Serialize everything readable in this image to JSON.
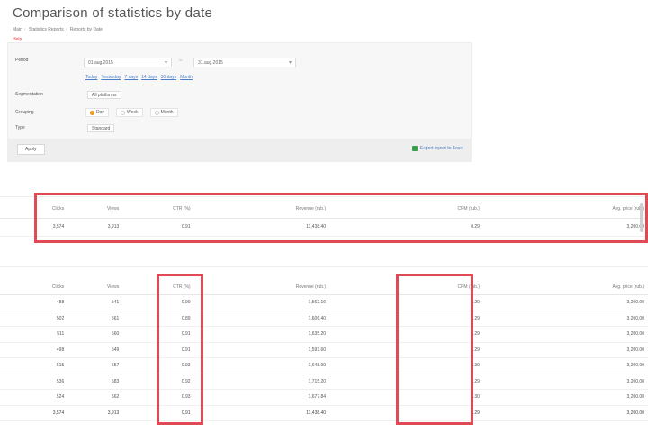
{
  "page": {
    "title": "Comparison of statistics by date",
    "breadcrumb": [
      "Main",
      "Statistics Reports",
      "Reports by Date"
    ],
    "note": "Help"
  },
  "filters": {
    "period_label": "Period",
    "date_from": "01.aug.2015",
    "date_to": "31.aug.2015",
    "date_separator": "~",
    "quick_ranges": [
      "Today",
      "Yesterday",
      "7 days",
      "14 days",
      "30 days",
      "Month"
    ],
    "segment_label": "Segmentation",
    "segment_value": "All platforms",
    "group_label": "Grouping",
    "group_options": [
      {
        "label": "Day",
        "selected": true
      },
      {
        "label": "Week",
        "selected": false
      },
      {
        "label": "Month",
        "selected": false
      }
    ],
    "type_label": "Type",
    "type_value": "Standard",
    "apply_label": "Apply",
    "export_label": "Export report to Excel"
  },
  "summary": {
    "headers": [
      "Clicks",
      "Views",
      "CTR (%)",
      "Revenue (rub.)",
      "CPM (rub.)",
      "Avg. price (rub.)"
    ],
    "row": [
      "3,574",
      "3,913",
      "0.91",
      "11,438.40",
      "0.29",
      "3,200.00"
    ]
  },
  "detail": {
    "headers": [
      "Clicks",
      "Views",
      "CTR (%)",
      "Revenue (rub.)",
      "CPM (rub.)",
      "Avg. price (rub.)"
    ],
    "rows": [
      [
        "488",
        "541",
        "0.90",
        "1,562.16",
        "0.29",
        "3,200.00"
      ],
      [
        "502",
        "561",
        "0.89",
        "1,606.40",
        "0.29",
        "3,200.00"
      ],
      [
        "511",
        "560",
        "0.91",
        "1,635.20",
        "0.29",
        "3,200.00"
      ],
      [
        "498",
        "549",
        "0.91",
        "1,593.60",
        "0.29",
        "3,200.00"
      ],
      [
        "515",
        "557",
        "0.92",
        "1,648.00",
        "0.30",
        "3,200.00"
      ],
      [
        "536",
        "583",
        "0.92",
        "1,715.20",
        "0.29",
        "3,200.00"
      ],
      [
        "524",
        "562",
        "0.93",
        "1,677.84",
        "0.30",
        "3,200.00"
      ]
    ],
    "total": [
      "3,574",
      "3,913",
      "0.91",
      "11,438.40",
      "0.29",
      "3,200.00"
    ]
  }
}
